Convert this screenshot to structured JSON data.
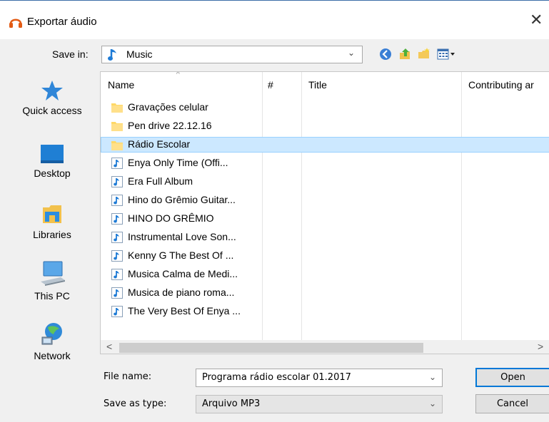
{
  "window": {
    "title": "Exportar áudio",
    "close_glyph": "✕"
  },
  "toolbar": {
    "save_in_label": "Save in:",
    "save_in_value": "Music",
    "chevron": "⌄",
    "icons": [
      "back-icon",
      "up-folder-icon",
      "new-folder-icon",
      "view-menu-icon"
    ]
  },
  "places": [
    {
      "label": "Quick access",
      "icon": "star-icon"
    },
    {
      "label": "Desktop",
      "icon": "desktop-icon"
    },
    {
      "label": "Libraries",
      "icon": "libraries-icon"
    },
    {
      "label": "This PC",
      "icon": "computer-icon"
    },
    {
      "label": "Network",
      "icon": "network-icon"
    }
  ],
  "columns": [
    "Name",
    "#",
    "Title",
    "Contributing ar"
  ],
  "files": [
    {
      "name": "Gravações celular",
      "type": "folder",
      "selected": false
    },
    {
      "name": "Pen drive 22.12.16",
      "type": "folder",
      "selected": false
    },
    {
      "name": "Rádio Escolar",
      "type": "folder",
      "selected": true
    },
    {
      "name": "Enya  Only Time (Offi...",
      "type": "audio",
      "selected": false
    },
    {
      "name": "Era Full Album",
      "type": "audio",
      "selected": false
    },
    {
      "name": "Hino do Grêmio Guitar...",
      "type": "audio",
      "selected": false
    },
    {
      "name": "HINO DO GRÊMIO",
      "type": "audio",
      "selected": false
    },
    {
      "name": "Instrumental Love Son...",
      "type": "audio",
      "selected": false
    },
    {
      "name": "Kenny G  The Best Of ...",
      "type": "audio",
      "selected": false
    },
    {
      "name": "Musica Calma de Medi...",
      "type": "audio",
      "selected": false
    },
    {
      "name": "Musica de piano roma...",
      "type": "audio",
      "selected": false
    },
    {
      "name": "The Very Best Of Enya  ...",
      "type": "audio",
      "selected": false
    }
  ],
  "scroll": {
    "left_arrow": "<",
    "right_arrow": ">"
  },
  "form": {
    "file_name_label": "File name:",
    "file_name_value": "Programa rádio escolar 01.2017",
    "save_as_label": "Save as type:",
    "save_as_value": "Arquivo MP3"
  },
  "buttons": {
    "open": "Open",
    "cancel": "Cancel"
  },
  "colors": {
    "selection": "#cce8ff",
    "accent": "#0078d7",
    "folder": "#ffd866"
  }
}
